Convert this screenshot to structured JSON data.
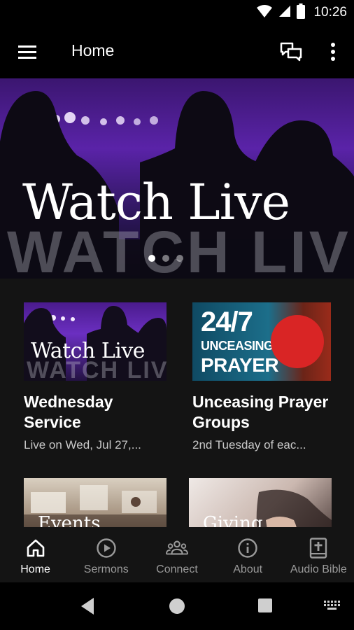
{
  "status_bar": {
    "time": "10:26",
    "icons": [
      "wifi-icon",
      "signal-icon",
      "battery-icon"
    ]
  },
  "app_bar": {
    "title": "Home",
    "icons": [
      "menu-icon",
      "chat-icon",
      "more-vert-icon"
    ]
  },
  "hero": {
    "title": "Watch Live",
    "ghost_text": "WATCH LIVE",
    "page_count": 3,
    "active_page": 1
  },
  "cards": [
    {
      "thumb_text": "Watch Live",
      "thumb_ghost": "WATCH LIVE",
      "title": "Wednesday Service",
      "subtitle": "Live on Wed, Jul 27,..."
    },
    {
      "thumb_text_1": "24/7",
      "thumb_text_2": "UNCEASING",
      "thumb_text_3": "PRAYER",
      "title": "Unceasing Prayer Groups",
      "subtitle": "2nd Tuesday of eac..."
    },
    {
      "thumb_text": "Events"
    },
    {
      "thumb_text": "Giving"
    }
  ],
  "bottom_nav": {
    "items": [
      {
        "label": "Home",
        "icon": "home-icon",
        "active": true
      },
      {
        "label": "Sermons",
        "icon": "play-circle-icon",
        "active": false
      },
      {
        "label": "Connect",
        "icon": "people-icon",
        "active": false
      },
      {
        "label": "About",
        "icon": "info-icon",
        "active": false
      },
      {
        "label": "Audio Bible",
        "icon": "bible-icon",
        "active": false
      }
    ]
  },
  "system_nav": {
    "icons": [
      "back-icon",
      "home-circle-icon",
      "recents-icon",
      "keyboard-icon"
    ]
  },
  "colors": {
    "background": "#141414",
    "bar": "#000000",
    "accent_red": "#d92525",
    "inactive_nav": "#9a9a9a"
  }
}
